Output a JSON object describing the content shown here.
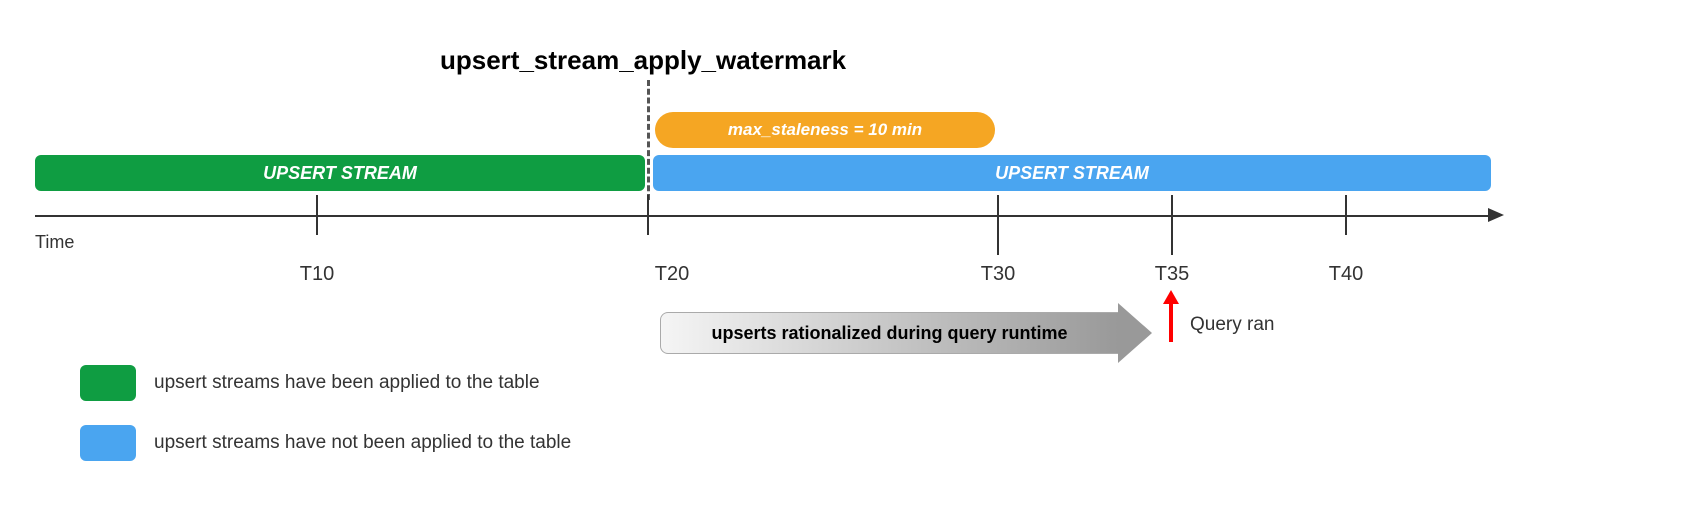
{
  "chart_data": {
    "type": "timeline",
    "axis_label": "Time",
    "ticks": [
      {
        "t": 10,
        "label": "T10"
      },
      {
        "t": 20,
        "label": "T20"
      },
      {
        "t": 30,
        "label": "T30"
      },
      {
        "t": 35,
        "label": "T35"
      },
      {
        "t": 40,
        "label": "T40"
      }
    ],
    "watermark": {
      "t": 20,
      "label": "upsert_stream_apply_watermark"
    },
    "staleness_window": {
      "start": 20,
      "end": 30,
      "label": "max_staleness = 10 min"
    },
    "segments": [
      {
        "name": "applied",
        "start": 0,
        "end": 20,
        "label": "UPSERT STREAM",
        "color": "#0f9d42"
      },
      {
        "name": "not_applied",
        "start": 20,
        "end": 42,
        "label": "UPSERT STREAM",
        "color": "#4aa5f0"
      }
    ],
    "rationalized": {
      "start": 20,
      "end": 35,
      "label": "upserts rationalized during query runtime"
    },
    "query_ran": {
      "t": 35,
      "label": "Query ran"
    }
  },
  "legend": {
    "applied": {
      "label": "upsert streams have been applied to the table",
      "color": "#0f9d42"
    },
    "not_applied": {
      "label": "upsert streams have not been applied to the table",
      "color": "#4aa5f0"
    }
  }
}
